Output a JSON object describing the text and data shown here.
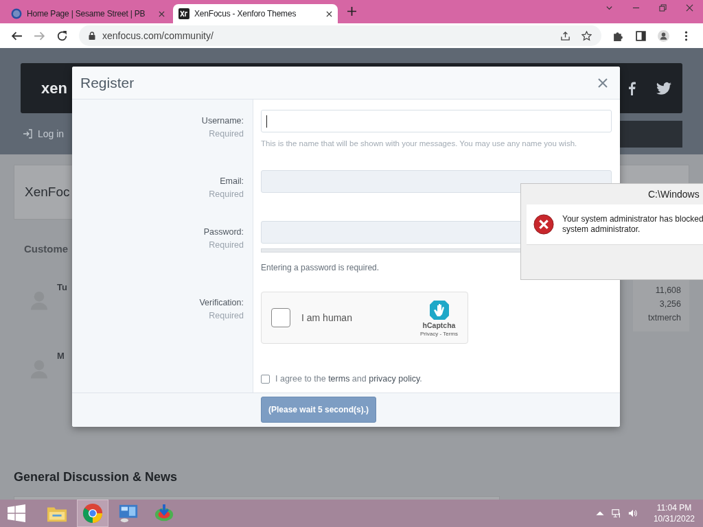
{
  "browser": {
    "tabs": [
      {
        "title": "Home Page | Sesame Street | PB",
        "selected": false
      },
      {
        "title": "XenFocus - Xenforo Themes",
        "selected": true
      }
    ],
    "url": "xenfocus.com/community/"
  },
  "site": {
    "brand": "xen",
    "login": "Log in",
    "card_title": "XenFoc",
    "section_title": "Custome",
    "members": [
      {
        "name": "Tu"
      },
      {
        "name": "M"
      }
    ],
    "stats": [
      "11,608",
      "3,256",
      "txtmerch"
    ],
    "forum_heading": "General Discussion & News"
  },
  "modal": {
    "title": "Register",
    "fields": [
      {
        "kind": "text",
        "label": "Username:",
        "note": "Required",
        "focused": true,
        "hint": "This is the name that will be shown with your messages. You may use any name you wish."
      },
      {
        "kind": "email",
        "label": "Email:",
        "note": "Required",
        "focused": false
      },
      {
        "kind": "password",
        "label": "Password:",
        "note": "Required",
        "focused": false,
        "level": 0,
        "hint": "Entering a password is required."
      },
      {
        "kind": "captcha",
        "label": "Verification:",
        "note": "Required",
        "checked": false,
        "text": "I am human",
        "brand": "hCaptcha",
        "links": "Privacy - Terms"
      }
    ],
    "agree": {
      "checked": false,
      "before": "I agree to the",
      "terms": "terms",
      "middle": "and",
      "privacy": "privacy policy",
      "after": "."
    },
    "submit": {
      "label": "(Please wait 5 second(s).)",
      "disabled": true
    }
  },
  "error_dialog": {
    "title": "C:\\Windows",
    "lines": [
      "Your system administrator has blocked",
      "system administrator."
    ]
  },
  "taskbar": {
    "apps": [
      {
        "kind": "explorer",
        "selected": false
      },
      {
        "kind": "chrome",
        "selected": true
      },
      {
        "kind": "control",
        "selected": false
      },
      {
        "kind": "download",
        "selected": false
      }
    ],
    "time": "11:04 PM",
    "date": "10/31/2022"
  }
}
